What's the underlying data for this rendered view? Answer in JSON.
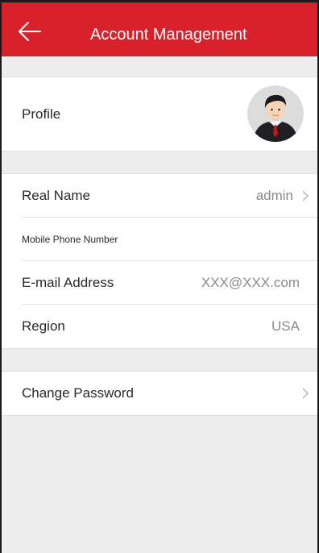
{
  "header": {
    "title": "Account Management",
    "back_icon": "arrow-left-icon",
    "background_color": "#d9212c"
  },
  "profile": {
    "label": "Profile",
    "avatar_icon": "user-avatar-icon"
  },
  "fields": {
    "real_name": {
      "label": "Real Name",
      "value": "admin"
    },
    "mobile_phone": {
      "label": "Mobile Phone Number",
      "value": ""
    },
    "email": {
      "label": "E-mail Address",
      "value": "XXX@XXX.com"
    },
    "region": {
      "label": "Region",
      "value": "USA"
    }
  },
  "security": {
    "change_password_label": "Change Password"
  }
}
